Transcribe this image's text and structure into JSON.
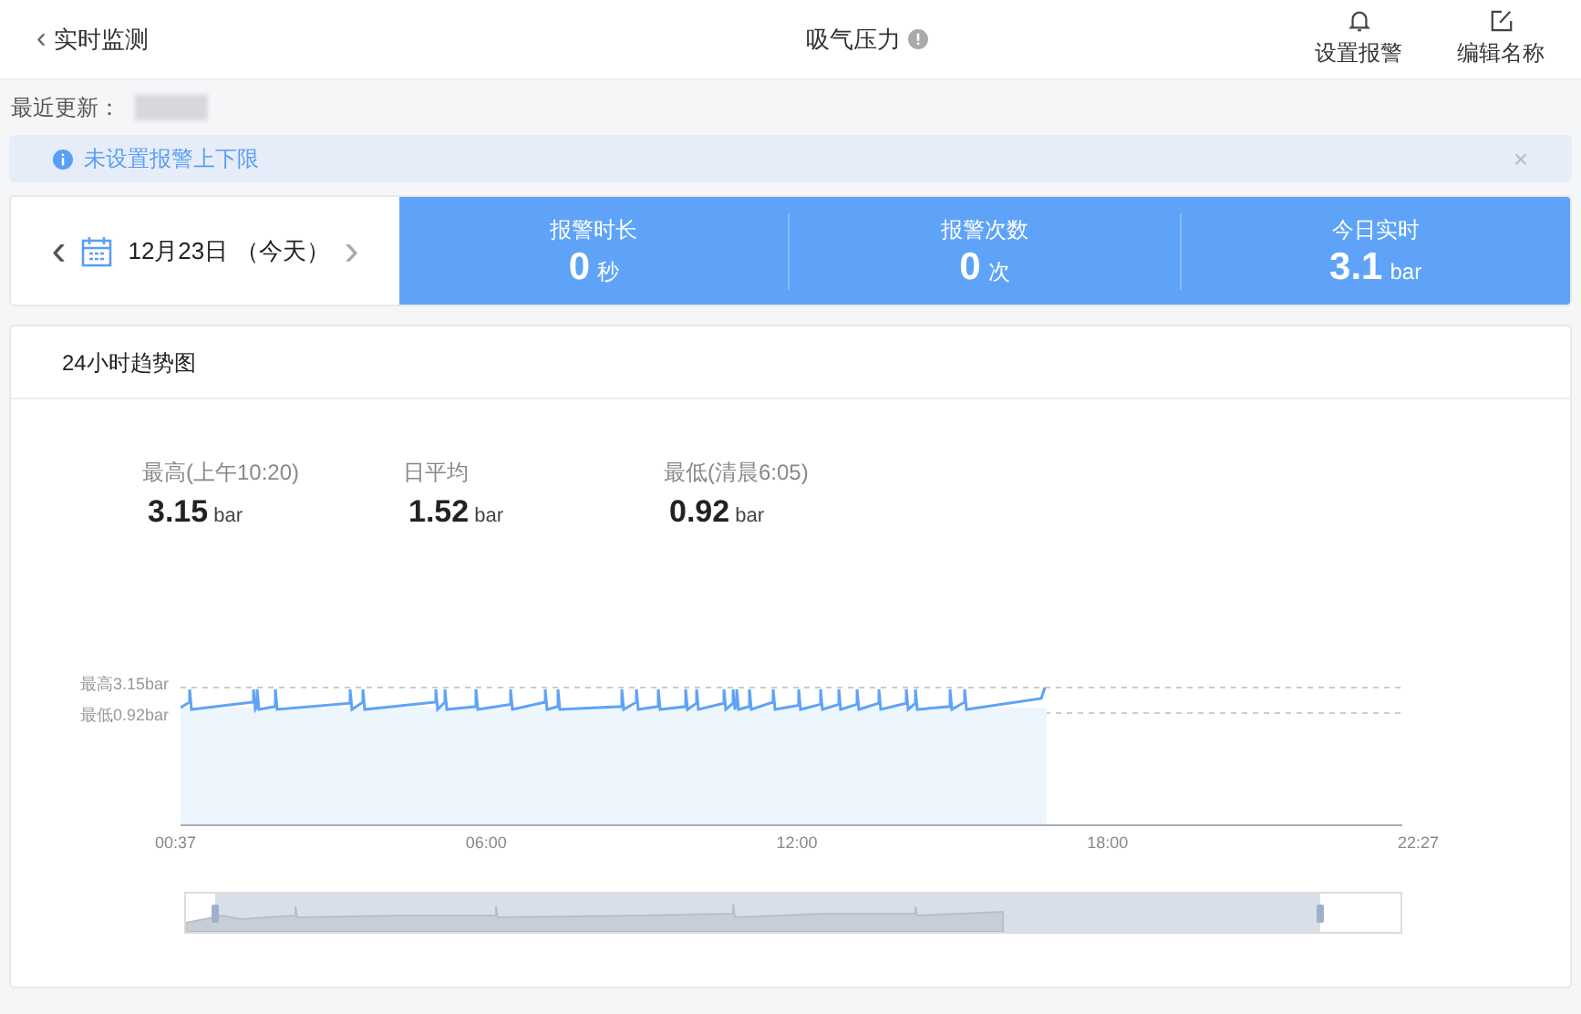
{
  "header": {
    "back": "‹",
    "back_label": "实时监测",
    "title": "吸气压力",
    "actions": [
      "设置报警",
      "编辑名称"
    ]
  },
  "update": {
    "label": "最近更新："
  },
  "alert": {
    "text": "未设置报警上下限",
    "close": "×"
  },
  "date": {
    "prev": "‹",
    "text": "12月23日 （今天）",
    "next": "›"
  },
  "stats": [
    {
      "label": "报警时长",
      "value": "0",
      "unit": "秒"
    },
    {
      "label": "报警次数",
      "value": "0",
      "unit": "次"
    },
    {
      "label": "今日实时",
      "value": "3.1",
      "unit": "bar"
    }
  ],
  "chart": {
    "title": "24小时趋势图",
    "summary": [
      {
        "label": "最高(上午10:20)",
        "value": "3.15",
        "unit": "bar"
      },
      {
        "label": "日平均",
        "value": "1.52",
        "unit": "bar"
      },
      {
        "label": "最低(清晨6:05)",
        "value": "0.92",
        "unit": "bar"
      }
    ],
    "max_line": "最高3.15bar",
    "min_line": "最低0.92bar",
    "xticks": [
      "00:37",
      "06:00",
      "12:00",
      "18:00",
      "22:27"
    ]
  }
}
